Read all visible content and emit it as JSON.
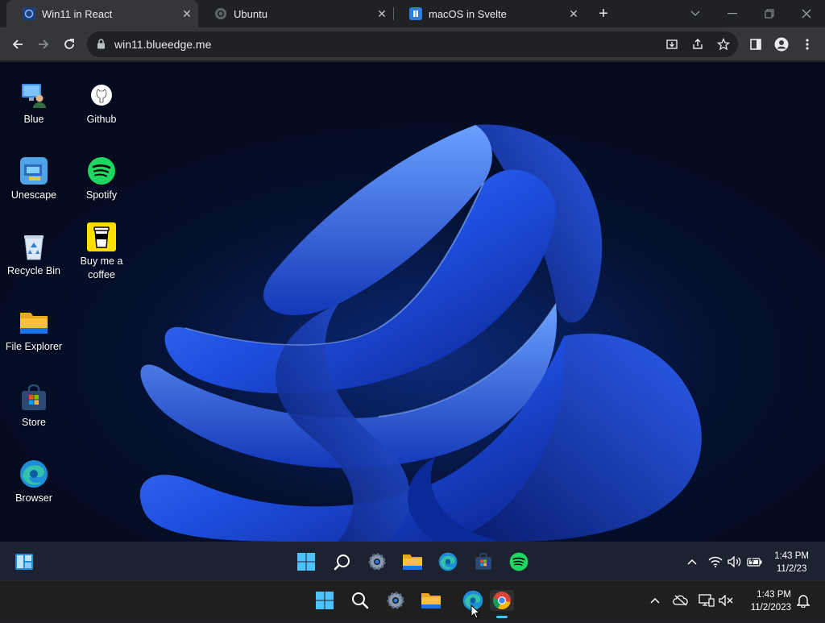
{
  "browser": {
    "tabs": [
      {
        "title": "Win11 in React",
        "active": true
      },
      {
        "title": "Ubuntu",
        "active": false
      },
      {
        "title": "macOS in Svelte",
        "active": false
      }
    ],
    "url": "win11.blueedge.me"
  },
  "desktop": {
    "icons": [
      {
        "label": "Blue",
        "icon": "user-pc-icon"
      },
      {
        "label": "Github",
        "icon": "github-icon"
      },
      {
        "label": "Unescape",
        "icon": "unescape-icon"
      },
      {
        "label": "Spotify",
        "icon": "spotify-icon"
      },
      {
        "label": "Recycle Bin",
        "icon": "recycle-bin-icon"
      },
      {
        "label": "Buy me a coffee",
        "icon": "coffee-icon"
      },
      {
        "label": "File Explorer",
        "icon": "folder-icon"
      },
      {
        "label": "Store",
        "icon": "store-icon"
      },
      {
        "label": "Browser",
        "icon": "edge-icon"
      }
    ]
  },
  "inner_taskbar": {
    "time": "1:43 PM",
    "date": "11/2/23"
  },
  "os_taskbar": {
    "time": "1:43 PM",
    "date": "11/2/2023"
  },
  "colors": {
    "accent_blue": "#1a73e8",
    "spotify_green": "#1ed760",
    "folder_yellow": "#f8c23b",
    "taskbar_active": "#4cc2ff"
  }
}
